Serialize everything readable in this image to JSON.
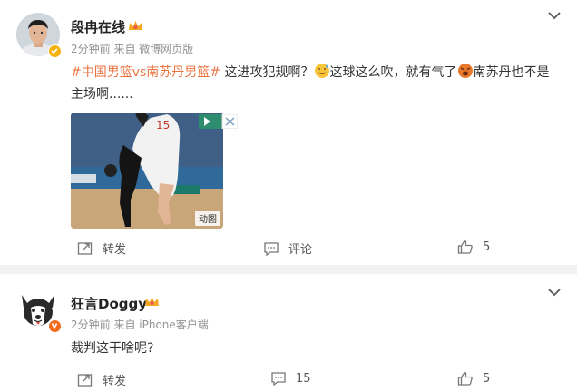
{
  "posts": [
    {
      "author": "段冉在线",
      "meta": "2分钟前  来自 微博网页版",
      "text": {
        "tag1": "#中国男篮vs南苏丹男篮#",
        "part1": "这进攻犯规啊？",
        "part2": "这球这么吹，就有气了",
        "part3": "南苏丹也不是主场啊......"
      },
      "media_badge": "动图",
      "actions": {
        "repost": "转发",
        "comment": "评论",
        "like": "5"
      },
      "colors": {
        "tag": "#eb7340",
        "verify": "#f6b10f"
      }
    },
    {
      "author": "狂言Doggy",
      "meta": "2分钟前  来自 iPhone客户端",
      "text": "裁判这干啥呢?",
      "actions": {
        "repost": "转发",
        "comment": "15",
        "like": "5"
      },
      "colors": {
        "verify": "#f26a1b"
      }
    }
  ],
  "icons": [
    "chevron-down-icon",
    "crown-icon",
    "verified-icon",
    "repost-icon",
    "comment-icon",
    "like-icon",
    "doge-icon",
    "gif-badge"
  ]
}
